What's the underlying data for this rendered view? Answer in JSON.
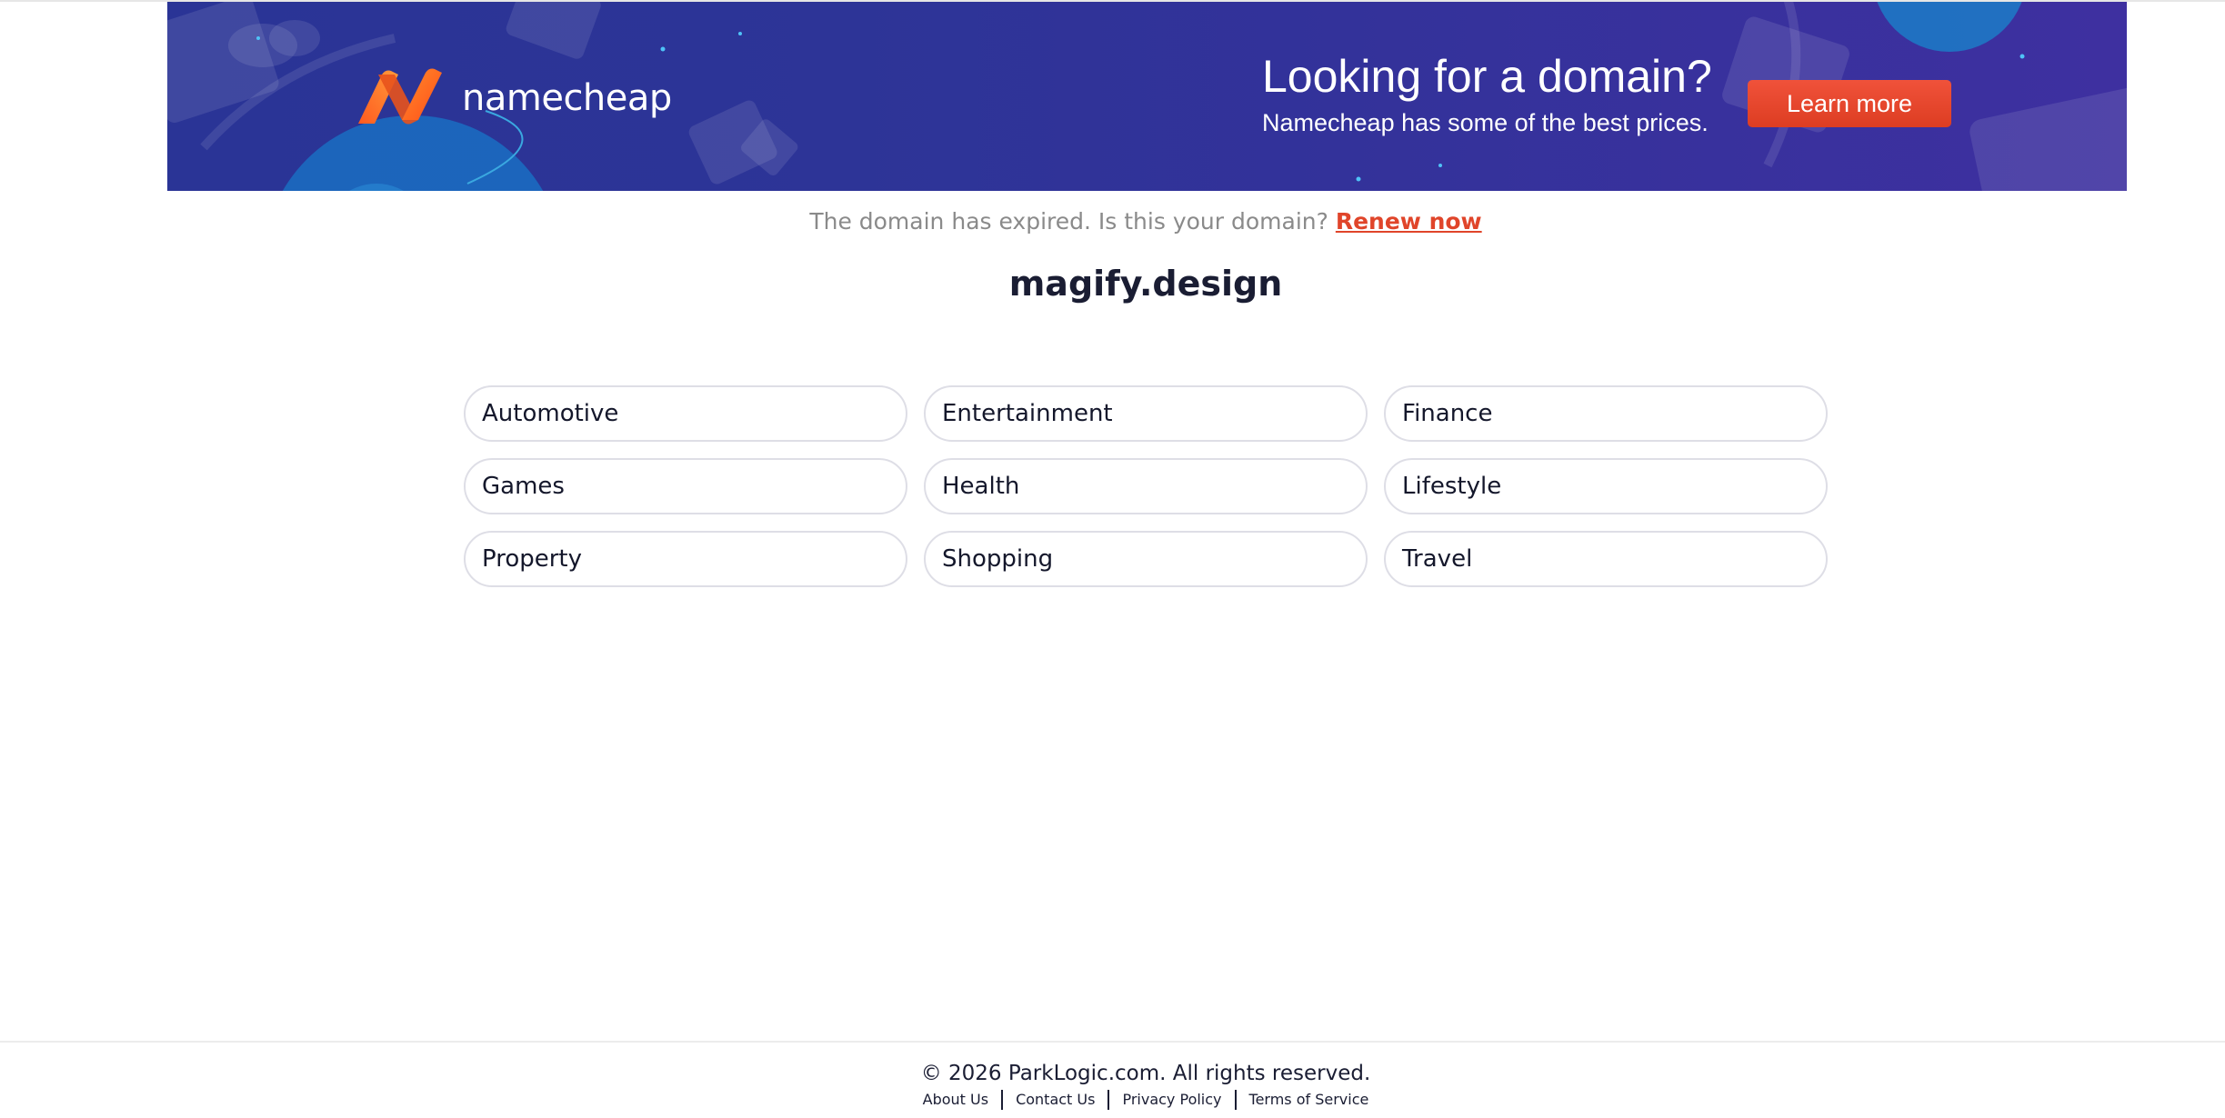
{
  "banner": {
    "logo_text": "namecheap",
    "logo_icon": "namecheap-n-logo-icon",
    "headline": "Looking for a domain?",
    "subline": "Namecheap has some of the best prices.",
    "cta_label": "Learn more",
    "colors": {
      "background": "#2d3497",
      "cta": "#e8472e",
      "logo_orange": "#ff6a1a"
    }
  },
  "notice": {
    "text": "The domain has expired. Is this your domain?",
    "link_label": "Renew now",
    "link_color": "#e0452a"
  },
  "domain": {
    "name": "magify.design"
  },
  "categories": [
    "Automotive",
    "Entertainment",
    "Finance",
    "Games",
    "Health",
    "Lifestyle",
    "Property",
    "Shopping",
    "Travel"
  ],
  "footer": {
    "copyright": "© 2026 ParkLogic.com. All rights reserved.",
    "links": [
      "About Us",
      "Contact Us",
      "Privacy Policy",
      "Terms of Service"
    ]
  }
}
